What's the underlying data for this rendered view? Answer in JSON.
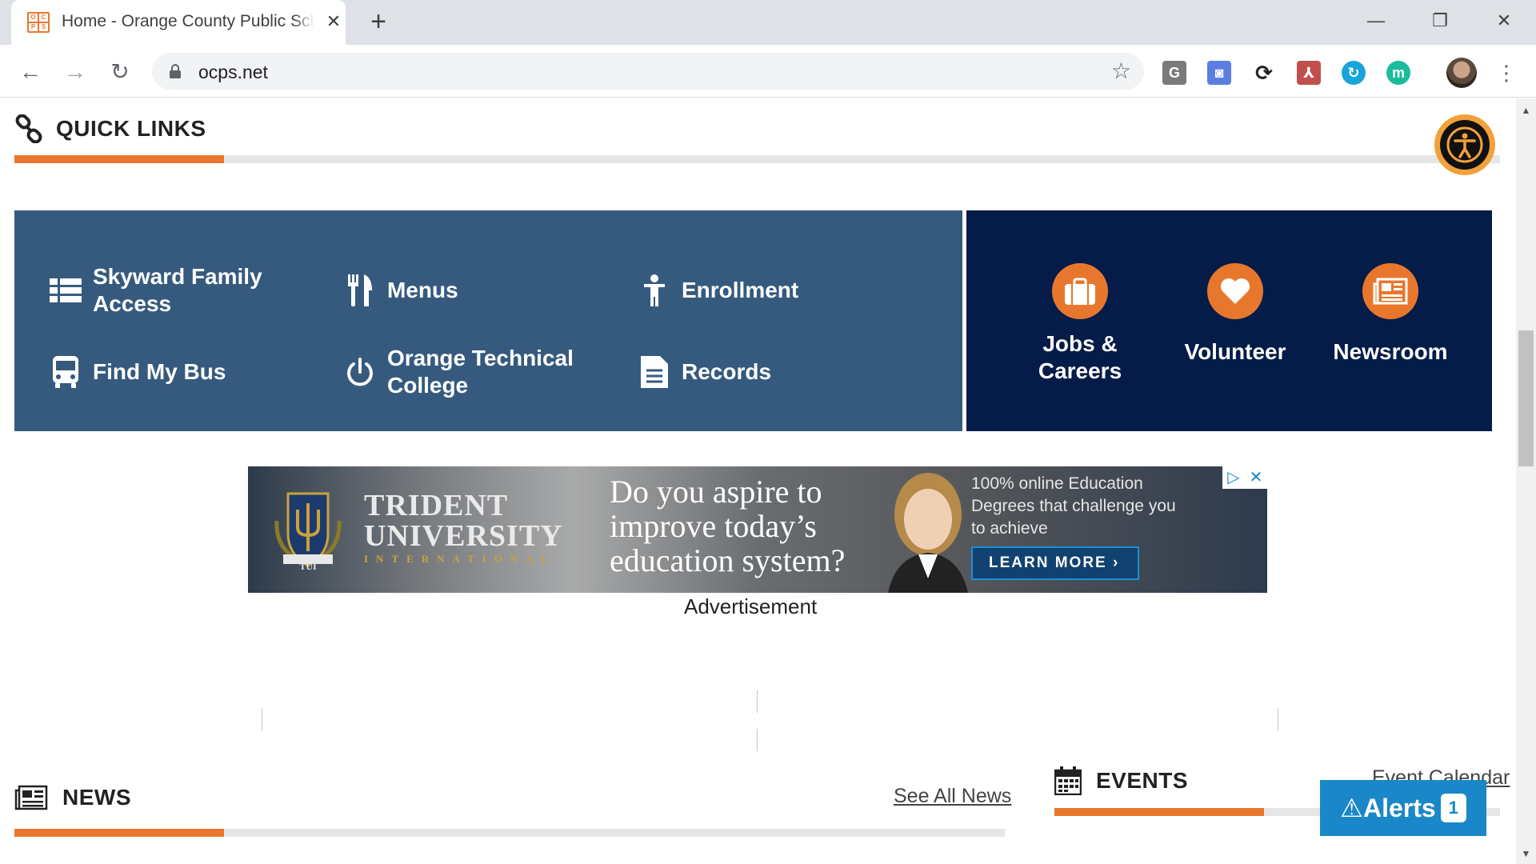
{
  "browser": {
    "tab": {
      "title": "Home - Orange County Public Schools",
      "close": "✕",
      "favicon_letters": [
        "O",
        "C",
        "P",
        "S"
      ]
    },
    "new_tab": "+",
    "window": {
      "minimize": "—",
      "restore": "❐",
      "close": "✕"
    },
    "nav": {
      "back": "←",
      "forward": "→",
      "reload": "↻"
    },
    "address": {
      "url": "ocps.net",
      "star": "☆"
    },
    "extensions": [
      {
        "name": "grammarly-extension",
        "label": "G",
        "color": "#7a7a7a"
      },
      {
        "name": "screenshot-extension",
        "label": "◙",
        "color": "#5b7ee0"
      },
      {
        "name": "sync-extension",
        "label": "⟳",
        "color": "#222222"
      },
      {
        "name": "pdf-extension",
        "label": "⅄",
        "color": "#c0504d"
      },
      {
        "name": "capture-extension",
        "label": "↻",
        "color": "#18a4d8"
      },
      {
        "name": "m-extension",
        "label": "m",
        "color": "#1abc9c"
      }
    ],
    "menu": "⋮",
    "scroll": {
      "up": "▲",
      "down": "▼"
    }
  },
  "quick_links": {
    "title": "QUICK LINKS",
    "items": [
      {
        "label": "Skyward Family Access"
      },
      {
        "label": "Menus"
      },
      {
        "label": "Enrollment"
      },
      {
        "label": "Find My Bus"
      },
      {
        "label": "Orange Technical College"
      },
      {
        "label": "Records"
      }
    ],
    "featured": [
      {
        "label": "Jobs & Careers"
      },
      {
        "label": "Volunteer"
      },
      {
        "label": "Newsroom"
      }
    ]
  },
  "ad": {
    "brand_line1": "TRIDENT",
    "brand_line2": "UNIVERSITY",
    "brand_sub": "INTERNATIONAL",
    "crest_text": "TUI",
    "headline": "Do you aspire to improve today’s education system?",
    "subtext": "100% online Education Degrees that challenge you to achieve",
    "cta": "LEARN MORE ›",
    "caption": "Advertisement",
    "choices_icon": "▷",
    "close_icon": "✕"
  },
  "news": {
    "title": "NEWS",
    "link": "See All News"
  },
  "events": {
    "title": "EVENTS",
    "link": "Event Calendar"
  },
  "alerts": {
    "label": "Alerts",
    "count": "1",
    "icon": "⚠"
  },
  "colors": {
    "accent": "#e8772e",
    "panel": "#365a7e",
    "panel_dark": "#051c48",
    "alerts": "#1a87c8"
  }
}
